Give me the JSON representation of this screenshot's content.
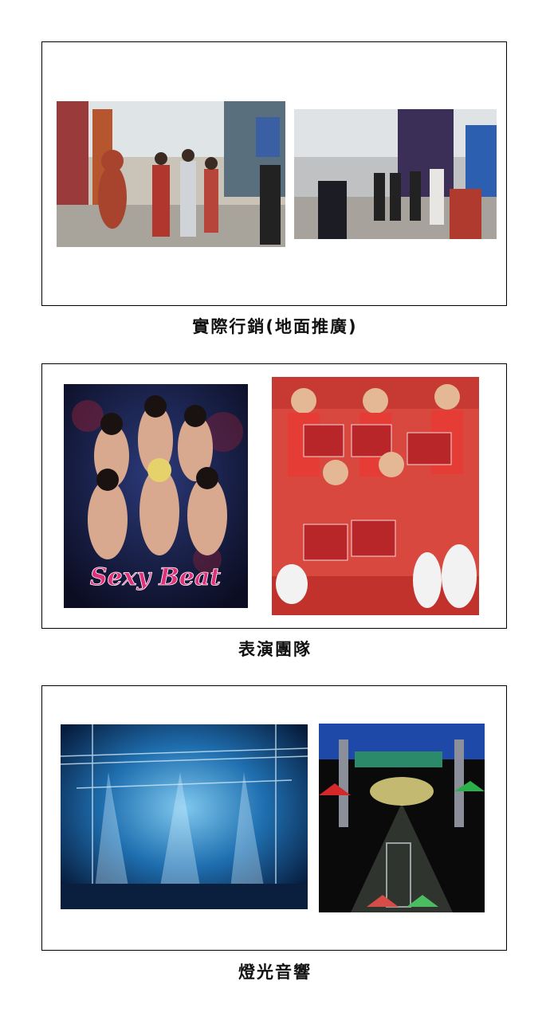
{
  "sections": [
    {
      "caption": "實際行銷(地面推廣)",
      "photos": [
        {
          "icon": "street-parade-photo"
        },
        {
          "icon": "street-crowd-photo"
        }
      ]
    },
    {
      "caption": "表演團隊",
      "photos": [
        {
          "icon": "dance-group-poster",
          "text": "Sexy Beat"
        },
        {
          "icon": "promo-girls-photo"
        }
      ]
    },
    {
      "caption": "燈光音響",
      "photos": [
        {
          "icon": "concert-stage-lighting-photo"
        },
        {
          "icon": "stage-truss-3d-rendering"
        }
      ]
    }
  ],
  "colors": {
    "border": "#000000",
    "poster_text": "#e0307a"
  }
}
